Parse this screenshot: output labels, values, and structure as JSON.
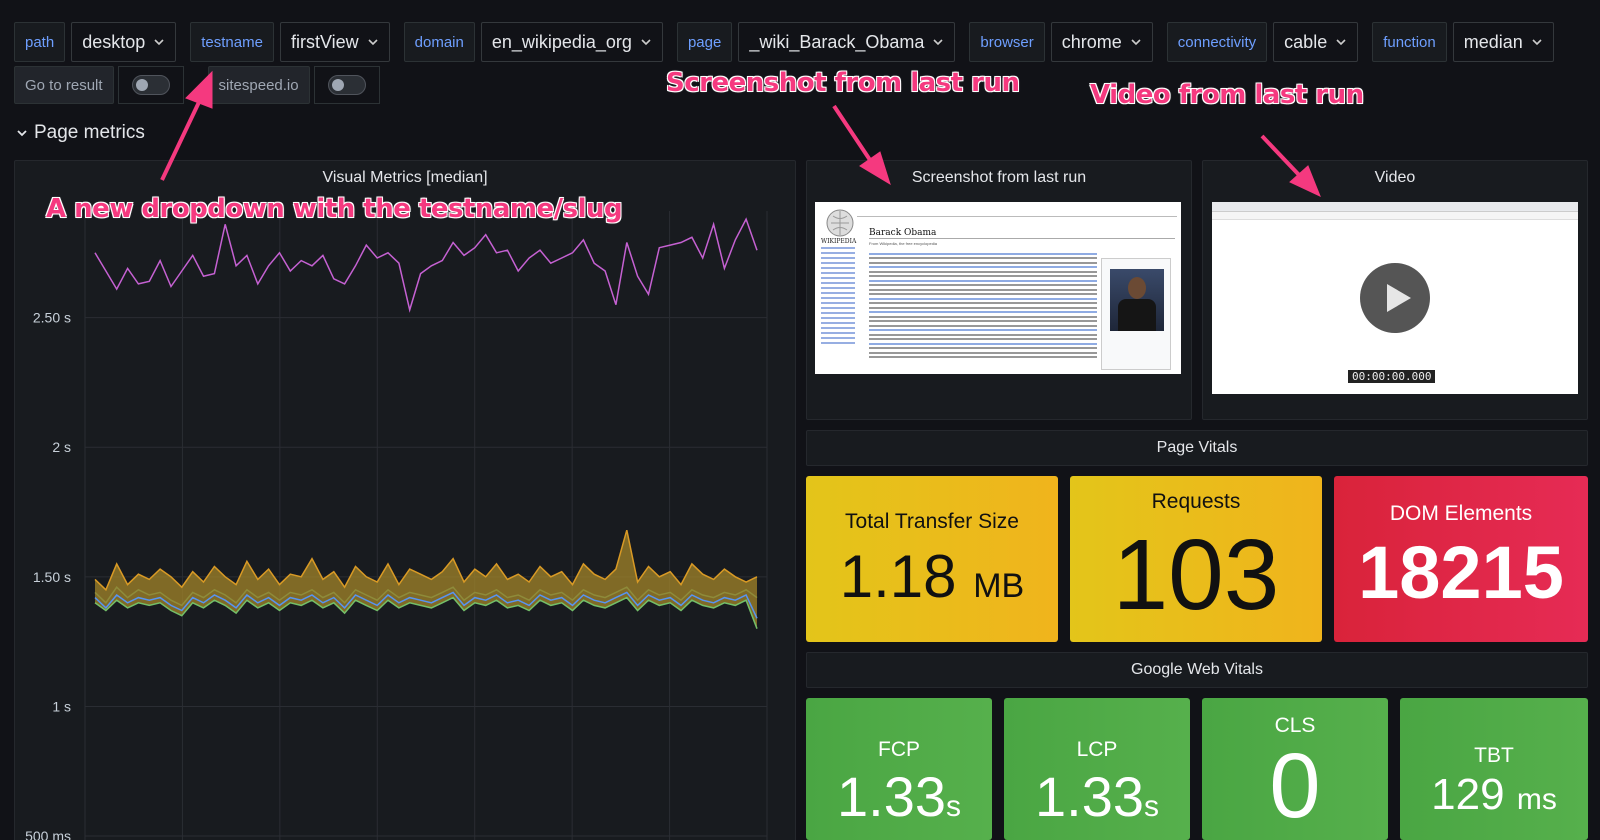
{
  "variables": [
    {
      "label": "path",
      "value": "desktop"
    },
    {
      "label": "testname",
      "value": "firstView"
    },
    {
      "label": "domain",
      "value": "en_wikipedia_org"
    },
    {
      "label": "page",
      "value": "_wiki_Barack_Obama"
    },
    {
      "label": "browser",
      "value": "chrome"
    },
    {
      "label": "connectivity",
      "value": "cable"
    },
    {
      "label": "function",
      "value": "median"
    }
  ],
  "links": {
    "goto_result": "Go to result",
    "sitespeed": "sitespeed.io"
  },
  "row_title": "Page metrics",
  "visual_metrics": {
    "title": "Visual Metrics [median]"
  },
  "screenshot_panel": {
    "title": "Screenshot from last run",
    "wiki_title": "Barack Obama",
    "wiki_sub": "From Wikipedia, the free encyclopedia",
    "wiki_logo": "WIKIPEDIA"
  },
  "video_panel": {
    "title": "Video",
    "timecode": "00:00:00.000"
  },
  "page_vitals": {
    "title": "Page Vitals",
    "stats": [
      {
        "label": "Total Transfer Size",
        "value": "1.18",
        "unit": "MB",
        "color": "#e8c417"
      },
      {
        "label": "Requests",
        "value": "103",
        "unit": "",
        "color": "#e8c417"
      },
      {
        "label": "DOM Elements",
        "value": "18215",
        "unit": "",
        "color": "#e0243d"
      }
    ]
  },
  "web_vitals": {
    "title": "Google Web Vitals",
    "stats": [
      {
        "label": "FCP",
        "value": "1.33",
        "unit": "s",
        "color": "#4eab46"
      },
      {
        "label": "LCP",
        "value": "1.33",
        "unit": "s",
        "color": "#4eab46"
      },
      {
        "label": "CLS",
        "value": "0",
        "unit": "",
        "color": "#4eab46"
      },
      {
        "label": "TBT",
        "value": "129",
        "unit": "ms",
        "color": "#4eab46"
      }
    ]
  },
  "annotations": {
    "screenshot": "Screenshot from last run",
    "video": "Video from last run",
    "dropdown": "A new dropdown with the testname/slug"
  },
  "chart_data": {
    "type": "line",
    "title": "Visual Metrics [median]",
    "y_unit": "s",
    "ylim": [
      0.45,
      2.95
    ],
    "yticks": [
      {
        "value": 0.5,
        "label": "500 ms"
      },
      {
        "value": 1.0,
        "label": "1 s"
      },
      {
        "value": 1.5,
        "label": "1.50 s"
      },
      {
        "value": 2.0,
        "label": "2 s"
      },
      {
        "value": 2.5,
        "label": "2.50 s"
      }
    ],
    "grid": true,
    "series": [
      {
        "color": "#c561d2",
        "values": [
          2.75,
          2.68,
          2.61,
          2.69,
          2.63,
          2.64,
          2.72,
          2.62,
          2.68,
          2.74,
          2.66,
          2.67,
          2.86,
          2.7,
          2.74,
          2.63,
          2.7,
          2.75,
          2.68,
          2.72,
          2.7,
          2.74,
          2.65,
          2.63,
          2.7,
          2.78,
          2.73,
          2.75,
          2.71,
          2.53,
          2.67,
          2.7,
          2.72,
          2.79,
          2.74,
          2.77,
          2.82,
          2.75,
          2.76,
          2.68,
          2.73,
          2.76,
          2.71,
          2.73,
          2.75,
          2.8,
          2.71,
          2.68,
          2.55,
          2.79,
          2.66,
          2.59,
          2.77,
          2.78,
          2.79,
          2.81,
          2.73,
          2.86,
          2.69,
          2.8,
          2.88,
          2.76
        ]
      },
      {
        "color": "#d99a25",
        "values": [
          1.49,
          1.45,
          1.55,
          1.47,
          1.51,
          1.49,
          1.53,
          1.5,
          1.46,
          1.52,
          1.48,
          1.54,
          1.5,
          1.47,
          1.56,
          1.49,
          1.53,
          1.47,
          1.51,
          1.5,
          1.57,
          1.49,
          1.52,
          1.46,
          1.54,
          1.5,
          1.48,
          1.55,
          1.47,
          1.53,
          1.51,
          1.49,
          1.52,
          1.57,
          1.48,
          1.53,
          1.5,
          1.55,
          1.49,
          1.51,
          1.48,
          1.54,
          1.5,
          1.52,
          1.47,
          1.55,
          1.51,
          1.49,
          1.53,
          1.68,
          1.48,
          1.54,
          1.5,
          1.52,
          1.47,
          1.55,
          1.51,
          1.49,
          1.53,
          1.5,
          1.48,
          1.5
        ]
      },
      {
        "color": "#8e8b3a",
        "values": [
          1.44,
          1.4,
          1.46,
          1.42,
          1.45,
          1.43,
          1.44,
          1.41,
          1.39,
          1.44,
          1.42,
          1.45,
          1.43,
          1.4,
          1.45,
          1.42,
          1.44,
          1.41,
          1.44,
          1.43,
          1.45,
          1.42,
          1.44,
          1.4,
          1.45,
          1.43,
          1.41,
          1.45,
          1.42,
          1.44,
          1.43,
          1.42,
          1.44,
          1.46,
          1.41,
          1.44,
          1.43,
          1.45,
          1.42,
          1.43,
          1.41,
          1.45,
          1.43,
          1.44,
          1.41,
          1.45,
          1.43,
          1.42,
          1.44,
          1.46,
          1.41,
          1.45,
          1.43,
          1.44,
          1.41,
          1.45,
          1.43,
          1.42,
          1.44,
          1.43,
          1.45,
          1.42
        ]
      },
      {
        "color": "#73bf69",
        "values": [
          1.4,
          1.37,
          1.41,
          1.38,
          1.4,
          1.39,
          1.4,
          1.37,
          1.35,
          1.4,
          1.38,
          1.41,
          1.39,
          1.36,
          1.41,
          1.38,
          1.4,
          1.37,
          1.4,
          1.39,
          1.41,
          1.38,
          1.4,
          1.36,
          1.41,
          1.39,
          1.37,
          1.41,
          1.38,
          1.4,
          1.39,
          1.38,
          1.4,
          1.42,
          1.37,
          1.4,
          1.39,
          1.41,
          1.38,
          1.39,
          1.37,
          1.41,
          1.39,
          1.4,
          1.37,
          1.41,
          1.39,
          1.38,
          1.4,
          1.42,
          1.37,
          1.41,
          1.39,
          1.4,
          1.37,
          1.41,
          1.39,
          1.38,
          1.4,
          1.39,
          1.41,
          1.3
        ]
      },
      {
        "color": "#5794f2",
        "values": [
          1.42,
          1.38,
          1.43,
          1.4,
          1.42,
          1.41,
          1.42,
          1.39,
          1.37,
          1.42,
          1.4,
          1.43,
          1.41,
          1.38,
          1.43,
          1.4,
          1.42,
          1.39,
          1.42,
          1.41,
          1.43,
          1.4,
          1.42,
          1.38,
          1.43,
          1.41,
          1.39,
          1.43,
          1.4,
          1.42,
          1.41,
          1.4,
          1.42,
          1.44,
          1.39,
          1.42,
          1.41,
          1.43,
          1.4,
          1.41,
          1.39,
          1.43,
          1.41,
          1.42,
          1.39,
          1.43,
          1.41,
          1.4,
          1.42,
          1.44,
          1.39,
          1.43,
          1.41,
          1.42,
          1.39,
          1.43,
          1.41,
          1.4,
          1.42,
          1.41,
          1.43,
          1.34
        ]
      }
    ]
  }
}
